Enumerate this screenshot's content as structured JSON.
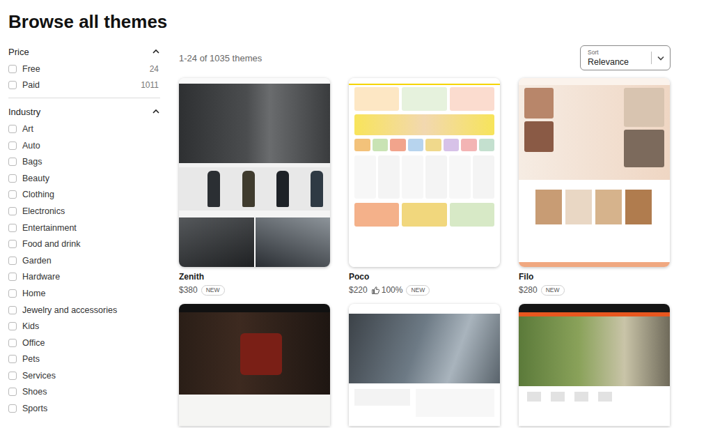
{
  "page": {
    "title": "Browse all themes"
  },
  "filters": [
    {
      "title": "Price",
      "expanded": true,
      "options": [
        {
          "label": "Free",
          "count": "24",
          "checked": false
        },
        {
          "label": "Paid",
          "count": "1011",
          "checked": false
        }
      ]
    },
    {
      "title": "Industry",
      "expanded": true,
      "options": [
        {
          "label": "Art",
          "checked": false
        },
        {
          "label": "Auto",
          "checked": false
        },
        {
          "label": "Bags",
          "checked": false
        },
        {
          "label": "Beauty",
          "checked": false
        },
        {
          "label": "Clothing",
          "checked": false
        },
        {
          "label": "Electronics",
          "checked": false
        },
        {
          "label": "Entertainment",
          "checked": false
        },
        {
          "label": "Food and drink",
          "checked": false
        },
        {
          "label": "Garden",
          "checked": false
        },
        {
          "label": "Hardware",
          "checked": false
        },
        {
          "label": "Home",
          "checked": false
        },
        {
          "label": "Jewelry and accessories",
          "checked": false
        },
        {
          "label": "Kids",
          "checked": false
        },
        {
          "label": "Office",
          "checked": false
        },
        {
          "label": "Pets",
          "checked": false
        },
        {
          "label": "Services",
          "checked": false
        },
        {
          "label": "Shoes",
          "checked": false
        },
        {
          "label": "Sports",
          "checked": false
        }
      ]
    }
  ],
  "results": {
    "summary": "1-24 of 1035 themes"
  },
  "sort": {
    "label": "Sort",
    "value": "Relevance"
  },
  "themes": [
    {
      "kind": "full",
      "name": "Zenith",
      "price": "$380",
      "badge": "NEW"
    },
    {
      "kind": "full",
      "name": "Poco",
      "price": "$220",
      "rating": "100%",
      "badge": "NEW"
    },
    {
      "kind": "full",
      "name": "Filo",
      "price": "$280",
      "badge": "NEW"
    },
    {
      "kind": "cut"
    },
    {
      "kind": "cut"
    },
    {
      "kind": "cut"
    }
  ]
}
